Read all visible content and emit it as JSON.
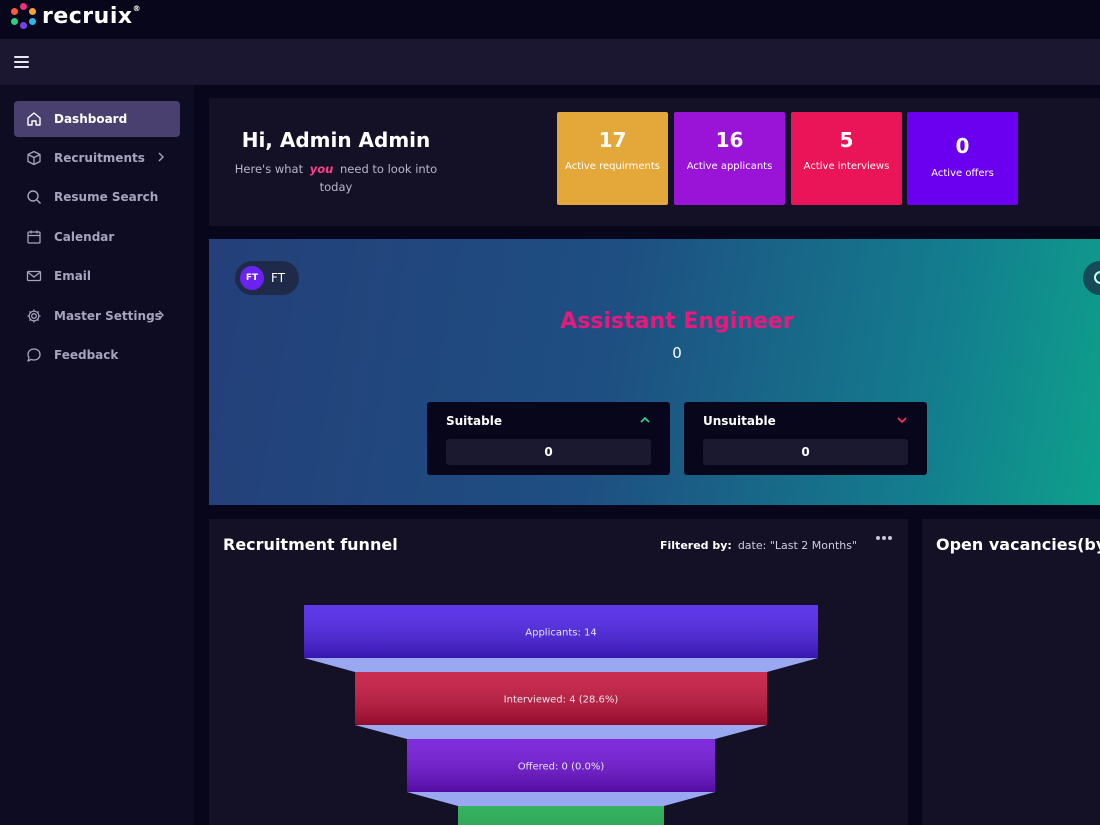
{
  "brand": {
    "name": "recruix",
    "mark": "®"
  },
  "sidebar": {
    "items": [
      {
        "label": "Dashboard"
      },
      {
        "label": "Recruitments"
      },
      {
        "label": "Resume Search"
      },
      {
        "label": "Calendar"
      },
      {
        "label": "Email"
      },
      {
        "label": "Master Settings"
      },
      {
        "label": "Feedback"
      }
    ]
  },
  "header": {
    "greeting": "Hi, Admin Admin",
    "sub_before": "Here's what",
    "sub_emphasis": "you",
    "sub_after": "need to look into today"
  },
  "stats": [
    {
      "value": "17",
      "label": "Active requirments",
      "color": "#e4a83a"
    },
    {
      "value": "16",
      "label": "Active applicants",
      "color": "#9a14d8"
    },
    {
      "value": "5",
      "label": "Active interviews",
      "color": "#ea1558"
    },
    {
      "value": "0",
      "label": "Active offers",
      "color": "#6b00f0"
    }
  ],
  "hero": {
    "chip_avatar": "FT",
    "chip_label": "FT",
    "job_title": "Assistant Engineer",
    "job_count": "0",
    "suitable": {
      "label": "Suitable",
      "value": "0"
    },
    "unsuitable": {
      "label": "Unsuitable",
      "value": "0"
    }
  },
  "funnel_card": {
    "title": "Recruitment funnel",
    "filter_label": "Filtered by:",
    "filter_value": "date: \"Last 2 Months\""
  },
  "vacancy_card": {
    "title": "Open vacancies(by c"
  },
  "chart_data": {
    "type": "funnel",
    "stages": [
      {
        "label": "Applicants: 14",
        "value": 14,
        "color": "#4a1ee8"
      },
      {
        "label": "Interviewed: 4 (28.6%)",
        "value": 4,
        "color": "#c4103a"
      },
      {
        "label": "Offered: 0 (0.0%)",
        "value": 0,
        "color": "#6f10d8"
      },
      {
        "label": "",
        "value": 0,
        "color": "#1aa84a"
      }
    ]
  }
}
